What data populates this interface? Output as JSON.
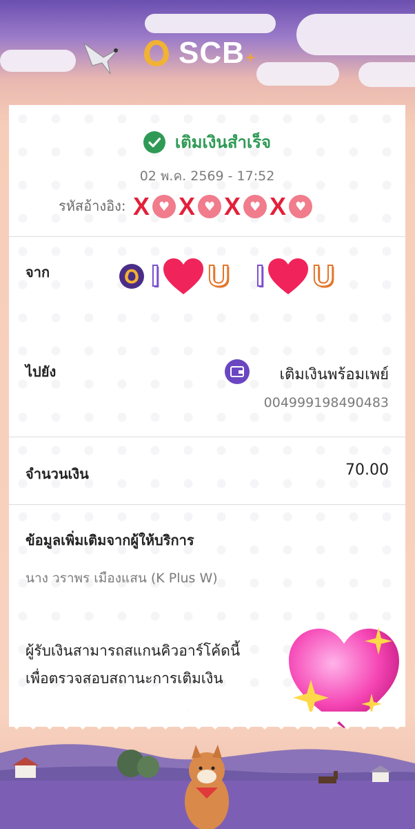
{
  "header": {
    "brand": "SCB",
    "brand_suffix": "+"
  },
  "receipt": {
    "status": "เติมเงินสำเร็จ",
    "datetime": "02 พ.ค. 2569 - 17:52",
    "ref_label": "รหัสอ้างอิง:",
    "from": {
      "label": "จาก"
    },
    "to": {
      "label": "ไปยัง",
      "name": "เติมเงินพร้อมเพย์",
      "account": "004999198490483"
    },
    "amount": {
      "label": "จำนวนเงิน",
      "value": "70.00"
    },
    "provider_info": {
      "label": "ข้อมูลเพิ่มเติมจากผู้ให้บริการ",
      "value": "นาง วราพร เมืองแสน (K Plus W)"
    },
    "qr_note_line1": "ผู้รับเงินสามารถสแกนคิวอาร์โค้ดนี้",
    "qr_note_line2": "เพื่อตรวจสอบสถานะการเติมเงิน"
  },
  "stickers": {
    "x": "X",
    "i": "I",
    "u": "U"
  },
  "colors": {
    "success": "#2f9a55",
    "brand_purple": "#4a2d86",
    "promptpay_purple": "#6a46c2",
    "sticker_red": "#e3203a"
  }
}
